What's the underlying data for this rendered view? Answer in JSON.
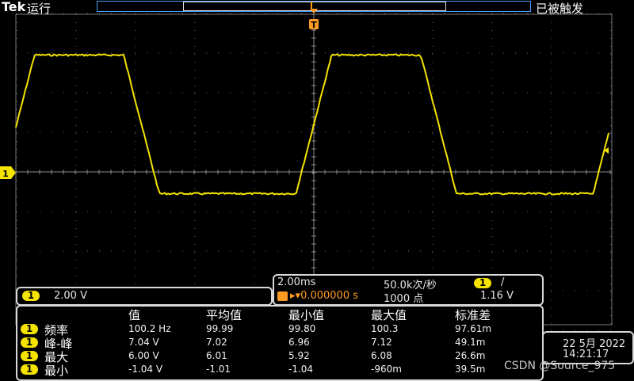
{
  "header": {
    "brand": "Tek",
    "run_state": "运行",
    "trigger_state": "已被触发"
  },
  "markers": {
    "trigger_icon": "T",
    "channel1_marker": "1"
  },
  "channel_panel": {
    "channel": "1",
    "scale": "2.00 V"
  },
  "horizontal_panel": {
    "time_div": "2.00ms",
    "sample_rate": "50.0k次/秒",
    "position": "0.000000 s",
    "record_length": "1000 点",
    "trigger_channel": "1",
    "trigger_slope": "/",
    "trigger_level": "1.16 V"
  },
  "measurements": {
    "headers": [
      "值",
      "平均值",
      "最小值",
      "最大值",
      "标准差"
    ],
    "rows": [
      {
        "ch": "1",
        "label": "频率",
        "values": [
          "100.2 Hz",
          "99.99",
          "99.80",
          "100.3",
          "97.61m"
        ]
      },
      {
        "ch": "1",
        "label": "峰-峰",
        "values": [
          "7.04 V",
          "7.02",
          "6.96",
          "7.12",
          "49.1m"
        ]
      },
      {
        "ch": "1",
        "label": "最大",
        "values": [
          "6.00 V",
          "6.01",
          "5.92",
          "6.08",
          "26.6m"
        ]
      },
      {
        "ch": "1",
        "label": "最小",
        "values": [
          "-1.04 V",
          "-1.01",
          "-1.04",
          "-960m",
          "39.5m"
        ]
      }
    ]
  },
  "datetime": {
    "date": "22 5月 2022",
    "time": "14:21:17"
  },
  "watermark": "CSDN @Source_975",
  "colors": {
    "trace": "#f5e300",
    "grid": "#5a5a5a",
    "accent": "#ff9a22"
  },
  "waveform": {
    "type": "trapezoid",
    "period_divisions": 5,
    "high_level_divisions": 2.95,
    "low_level_divisions": -0.55
  }
}
